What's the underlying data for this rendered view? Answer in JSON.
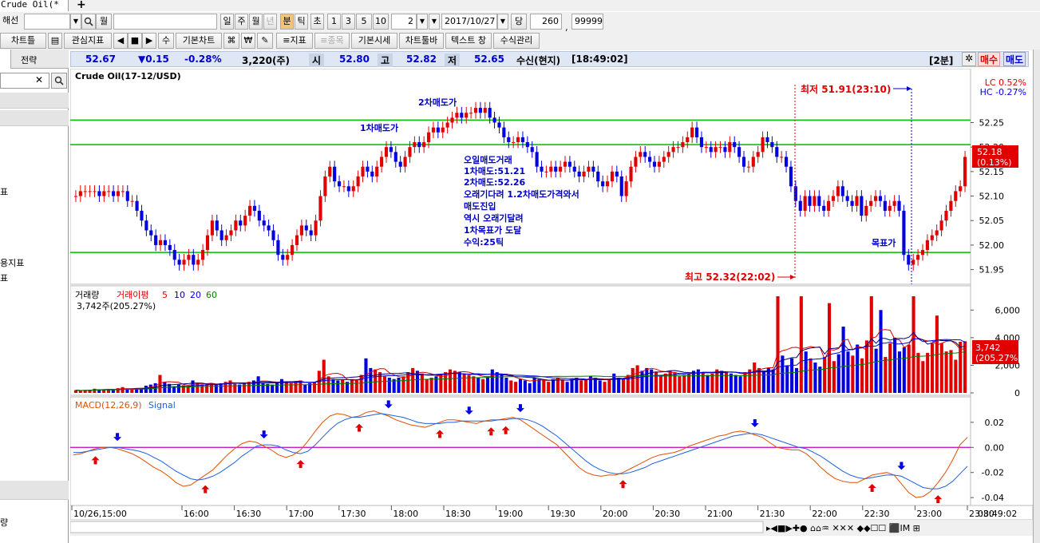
{
  "window": {
    "tab_title": "Crude Oil(*",
    "add_tab": "+"
  },
  "toolbar1": {
    "item1": "해선",
    "search_icon": "search-icon",
    "period_month": "월",
    "periods": [
      "일",
      "주",
      "월",
      "년",
      "분",
      "틱",
      "초"
    ],
    "active_period": "분",
    "numbers": [
      "1",
      "3",
      "5",
      "10"
    ],
    "interval": "2",
    "date": "2017/10/27",
    "date_suffix": "당",
    "count": "260",
    "slash": "/",
    "max": "99999"
  },
  "toolbar2": {
    "buttons": [
      "차트틀",
      "관심지표",
      "수",
      "기본차트",
      "₩",
      "≡지표",
      "≡종목",
      "기본시세",
      "차트툴바",
      "텍스트 창",
      "수식관리"
    ]
  },
  "left_panel": {
    "tab1": "",
    "tab2": "전략",
    "items": [
      "표",
      "용지표",
      "표"
    ],
    "bottom_item": "량"
  },
  "info": {
    "price": "52.67",
    "change": "▼0.15",
    "change_pct": "-0.28%",
    "volume": "3,220(주)",
    "open_label": "시",
    "open": "52.80",
    "high_label": "고",
    "high": "52.82",
    "low_label": "저",
    "low": "52.65",
    "status": "수신(현지)",
    "time": "[18:49:02]",
    "interval_label": "[2분]",
    "buy": "매수",
    "sell": "매도"
  },
  "colors": {
    "up": "#e00000",
    "down": "#0000e0",
    "green_line": "#00bb00",
    "macd": "#e05000",
    "signal": "#2060e0",
    "zero": "#c000c0"
  },
  "chart_data": [
    {
      "type": "candlestick",
      "title": "Crude Oil(17-12/USD)",
      "y_ticks": [
        "52.25",
        "52.20",
        "52.15",
        "52.10",
        "52.05",
        "52.00",
        "51.95"
      ],
      "ylim": [
        51.92,
        52.36
      ],
      "legend_lc": "LC 0.52%",
      "legend_hc": "HC -0.27%",
      "current_price": "52.18",
      "current_pct": "(0.13%)",
      "horizontal_lines": [
        52.255,
        52.205,
        51.985
      ],
      "annotations": {
        "sell1": "1차매도가",
        "sell2": "2차매도가",
        "target": "목표가",
        "note": [
          "오일매도거래",
          "1차매도:51.21",
          "2차매도:52.26",
          "오래기다려 1.2차매도가격와서",
          "매도진입",
          "역시 오래기달려",
          "1차목표가 도달",
          "수익:25틱"
        ],
        "low_label": "최저 51.91(23:10)",
        "high_label": "최고 52.32(22:02)"
      },
      "close": [
        52.1,
        52.11,
        52.11,
        52.11,
        52.11,
        52.1,
        52.11,
        52.11,
        52.1,
        52.11,
        52.11,
        52.09,
        52.09,
        52.07,
        52.05,
        52.03,
        52.02,
        52.0,
        52.01,
        52.0,
        51.99,
        51.97,
        51.96,
        51.97,
        51.98,
        51.96,
        51.97,
        51.99,
        52.02,
        52.05,
        52.03,
        52.01,
        52.02,
        52.03,
        52.05,
        52.04,
        52.06,
        52.08,
        52.07,
        52.05,
        52.04,
        52.03,
        52.01,
        51.98,
        51.97,
        51.98,
        52.0,
        52.02,
        52.04,
        52.03,
        52.02,
        52.05,
        52.1,
        52.14,
        52.16,
        52.13,
        52.12,
        52.12,
        52.11,
        52.12,
        52.14,
        52.16,
        52.15,
        52.14,
        52.16,
        52.18,
        52.2,
        52.19,
        52.17,
        52.16,
        52.18,
        52.2,
        52.21,
        52.2,
        52.21,
        52.23,
        52.24,
        52.23,
        52.24,
        52.25,
        52.26,
        52.27,
        52.26,
        52.27,
        52.27,
        52.28,
        52.27,
        52.28,
        52.26,
        52.25,
        52.24,
        52.22,
        52.21,
        52.21,
        52.22,
        52.21,
        52.2,
        52.19,
        52.16,
        52.15,
        52.15,
        52.16,
        52.15,
        52.16,
        52.17,
        52.16,
        52.15,
        52.14,
        52.15,
        52.16,
        52.15,
        52.13,
        52.12,
        52.13,
        52.15,
        52.14,
        52.1,
        52.13,
        52.16,
        52.18,
        52.19,
        52.18,
        52.17,
        52.16,
        52.17,
        52.18,
        52.19,
        52.2,
        52.2,
        52.21,
        52.22,
        52.24,
        52.22,
        52.2,
        52.2,
        52.19,
        52.2,
        52.2,
        52.19,
        52.21,
        52.2,
        52.18,
        52.16,
        52.16,
        52.18,
        52.19,
        52.22,
        52.21,
        52.2,
        52.18,
        52.18,
        52.16,
        52.12,
        52.09,
        52.07,
        52.1,
        52.08,
        52.1,
        52.08,
        52.07,
        52.09,
        52.1,
        52.12,
        52.1,
        52.09,
        52.08,
        52.1,
        52.06,
        52.08,
        52.09,
        52.1,
        52.09,
        52.07,
        52.08,
        52.09,
        52.07,
        51.98,
        51.96,
        51.97,
        51.98,
        51.99,
        52.01,
        52.02,
        52.03,
        52.05,
        52.07,
        52.09,
        52.11,
        52.12,
        52.18
      ],
      "x_ticks": [
        "10/26,15:00",
        "16:00",
        "16:30",
        "17:00",
        "17:30",
        "18:00",
        "18:30",
        "19:00",
        "19:30",
        "20:00",
        "20:30",
        "21:00",
        "21:30",
        "22:00",
        "22:30",
        "23:00",
        "23:30"
      ],
      "x_corner_time": "08:49:02"
    },
    {
      "type": "bar",
      "title": "거래량",
      "legend": [
        "거래이평",
        "5",
        "10",
        "20",
        "60"
      ],
      "value_label": "3,742주(205.27%)",
      "y_ticks": [
        "6,000",
        "4,000",
        "2,000",
        "0"
      ],
      "ylim": [
        0,
        7000
      ],
      "current_value": "3,742",
      "current_pct": "(205.27%)",
      "values": [
        200,
        150,
        180,
        220,
        300,
        260,
        250,
        280,
        200,
        340,
        420,
        300,
        280,
        310,
        350,
        520,
        600,
        700,
        1300,
        800,
        650,
        480,
        600,
        550,
        500,
        900,
        700,
        600,
        620,
        680,
        600,
        700,
        800,
        900,
        650,
        600,
        700,
        800,
        900,
        1200,
        700,
        650,
        600,
        750,
        1000,
        800,
        700,
        850,
        900,
        600,
        700,
        800,
        1600,
        2400,
        1200,
        1000,
        900,
        950,
        800,
        1000,
        900,
        1300,
        2500,
        1800,
        1700,
        1500,
        1200,
        1100,
        1000,
        1100,
        1200,
        1500,
        1800,
        1600,
        1400,
        1000,
        1100,
        1200,
        1300,
        1500,
        1700,
        1600,
        1500,
        1400,
        1300,
        1200,
        1100,
        1000,
        1200,
        1700,
        1500,
        1300,
        1100,
        900,
        800,
        1000,
        900,
        700,
        1100,
        1000,
        900,
        800,
        1000,
        1100,
        900,
        800,
        1000,
        1100,
        900,
        1000,
        1200,
        1100,
        900,
        800,
        1000,
        1400,
        1100,
        1000,
        1300,
        1800,
        2000,
        1600,
        1800,
        1700,
        1500,
        1300,
        1400,
        1600,
        1500,
        1200,
        1300,
        1400,
        1600,
        1700,
        1500,
        1300,
        1400,
        1700,
        1600,
        1500,
        1400,
        1300,
        1200,
        1500,
        1700,
        2200,
        1800,
        1600,
        1800,
        1700,
        7500,
        2700,
        2000,
        2500,
        1800,
        7000,
        3000,
        2500,
        2200,
        1900,
        2600,
        6500,
        2300,
        2800,
        4800,
        3000,
        2700,
        3500,
        2500,
        3800,
        7300,
        3200,
        6000,
        2600,
        3600,
        4000,
        3000,
        3300,
        3500,
        7200,
        2900,
        2300,
        2900,
        3600,
        5600,
        3600,
        3000,
        3100,
        2400,
        3700,
        3742
      ]
    },
    {
      "type": "line",
      "title": "MACD(12,26,9)",
      "signal_label": "Signal",
      "y_ticks": [
        "0.02",
        "0.00",
        "-0.02",
        "-0.04"
      ],
      "ylim": [
        -0.045,
        0.032
      ],
      "series": [
        {
          "name": "MACD(12,26,9)",
          "values": [
            -0.006,
            -0.005,
            -0.003,
            -0.001,
            0.0,
            0.0,
            -0.001,
            -0.003,
            -0.005,
            -0.008,
            -0.012,
            -0.016,
            -0.019,
            -0.023,
            -0.028,
            -0.031,
            -0.03,
            -0.026,
            -0.022,
            -0.018,
            -0.012,
            -0.006,
            -0.001,
            0.003,
            0.005,
            0.004,
            0.001,
            -0.002,
            -0.006,
            -0.008,
            -0.006,
            -0.002,
            0.005,
            0.013,
            0.02,
            0.025,
            0.027,
            0.026,
            0.024,
            0.025,
            0.028,
            0.029,
            0.027,
            0.025,
            0.022,
            0.02,
            0.018,
            0.017,
            0.016,
            0.018,
            0.02,
            0.022,
            0.022,
            0.021,
            0.02,
            0.019,
            0.021,
            0.022,
            0.022,
            0.023,
            0.024,
            0.022,
            0.018,
            0.014,
            0.01,
            0.006,
            0.002,
            -0.004,
            -0.01,
            -0.016,
            -0.02,
            -0.022,
            -0.023,
            -0.022,
            -0.022,
            -0.02,
            -0.017,
            -0.014,
            -0.011,
            -0.008,
            -0.006,
            -0.005,
            -0.004,
            -0.002,
            0.001,
            0.003,
            0.005,
            0.007,
            0.009,
            0.01,
            0.012,
            0.013,
            0.012,
            0.01,
            0.008,
            0.004,
            0.0,
            -0.001,
            -0.002,
            -0.002,
            -0.005,
            -0.01,
            -0.016,
            -0.021,
            -0.025,
            -0.027,
            -0.028,
            -0.028,
            -0.025,
            -0.022,
            -0.021,
            -0.02,
            -0.022,
            -0.029,
            -0.036,
            -0.04,
            -0.039,
            -0.035,
            -0.028,
            -0.02,
            -0.01,
            0.002,
            0.008
          ]
        },
        {
          "name": "Signal",
          "values": [
            -0.004,
            -0.004,
            -0.003,
            -0.002,
            -0.001,
            0.0,
            0.0,
            -0.001,
            -0.002,
            -0.003,
            -0.005,
            -0.008,
            -0.011,
            -0.015,
            -0.019,
            -0.022,
            -0.025,
            -0.026,
            -0.025,
            -0.023,
            -0.02,
            -0.016,
            -0.012,
            -0.007,
            -0.003,
            0.001,
            0.002,
            0.002,
            0.001,
            -0.002,
            -0.004,
            -0.005,
            -0.003,
            0.002,
            0.008,
            0.014,
            0.019,
            0.022,
            0.024,
            0.024,
            0.025,
            0.026,
            0.027,
            0.026,
            0.025,
            0.024,
            0.022,
            0.02,
            0.019,
            0.019,
            0.019,
            0.02,
            0.02,
            0.021,
            0.021,
            0.021,
            0.021,
            0.021,
            0.022,
            0.022,
            0.023,
            0.023,
            0.022,
            0.02,
            0.017,
            0.013,
            0.009,
            0.004,
            -0.001,
            -0.006,
            -0.011,
            -0.015,
            -0.018,
            -0.02,
            -0.021,
            -0.021,
            -0.02,
            -0.018,
            -0.016,
            -0.013,
            -0.011,
            -0.009,
            -0.007,
            -0.005,
            -0.003,
            -0.001,
            0.001,
            0.003,
            0.005,
            0.007,
            0.009,
            0.01,
            0.011,
            0.011,
            0.01,
            0.008,
            0.006,
            0.004,
            0.002,
            0.0,
            -0.001,
            -0.004,
            -0.007,
            -0.011,
            -0.015,
            -0.019,
            -0.022,
            -0.024,
            -0.025,
            -0.024,
            -0.023,
            -0.022,
            -0.022,
            -0.023,
            -0.026,
            -0.029,
            -0.032,
            -0.033,
            -0.033,
            -0.031,
            -0.027,
            -0.021,
            -0.015
          ]
        }
      ]
    }
  ]
}
